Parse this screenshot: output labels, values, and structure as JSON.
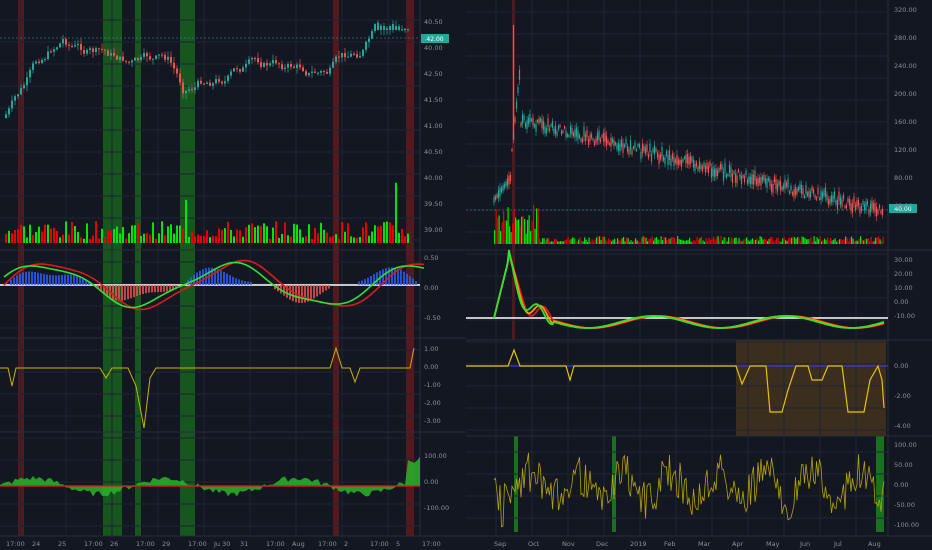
{
  "left_chart": {
    "x_ticks": [
      "17:00",
      "24",
      "25",
      "17:00",
      "26",
      "17:00",
      "29",
      "17:00",
      "Ju 30",
      "31",
      "17:00",
      "Aug",
      "17:00",
      "2",
      "17:00",
      "5",
      "17:00"
    ],
    "price_ticks": [
      "40.50",
      "40.00",
      "42.50",
      "41.50",
      "41.00",
      "40.50",
      "40.00",
      "39.50",
      "39.00"
    ],
    "price_tag": "42.00",
    "macd_ticks": [
      "0.50",
      "0.00",
      "-0.50"
    ],
    "osc_ticks": [
      "1.00",
      "0.00",
      "-1.00",
      "-2.00",
      "-3.00"
    ],
    "cci_ticks": [
      "100.00",
      "0.00",
      "-100.00"
    ]
  },
  "right_chart": {
    "x_ticks": [
      "Sep",
      "Oct",
      "Nov",
      "Dec",
      "2019",
      "Feb",
      "Mar",
      "Apr",
      "May",
      "Jun",
      "Jul",
      "Aug"
    ],
    "price_ticks": [
      "320.00",
      "280.00",
      "240.00",
      "200.00",
      "160.00",
      "120.00",
      "80.00",
      "40.00"
    ],
    "price_tag": "40.00",
    "macd_ticks": [
      "30.00",
      "20.00",
      "10.00",
      "0.00",
      "-10.00"
    ],
    "osc_ticks": [
      "0.00",
      "-2.00",
      "-4.00"
    ],
    "cci_ticks": [
      "100.00",
      "50.00",
      "0.00",
      "-50.00",
      "-100.00"
    ]
  },
  "colors": {
    "background": "#131722",
    "up": "#26a69a",
    "down": "#ef5350",
    "green_volume": "#00e600",
    "red_volume": "#e60000",
    "highlight_green": "#1b8a1b",
    "highlight_red": "#8a1b1b",
    "yellow_line": "#c8b400",
    "blue_line": "#3a3ad6"
  }
}
